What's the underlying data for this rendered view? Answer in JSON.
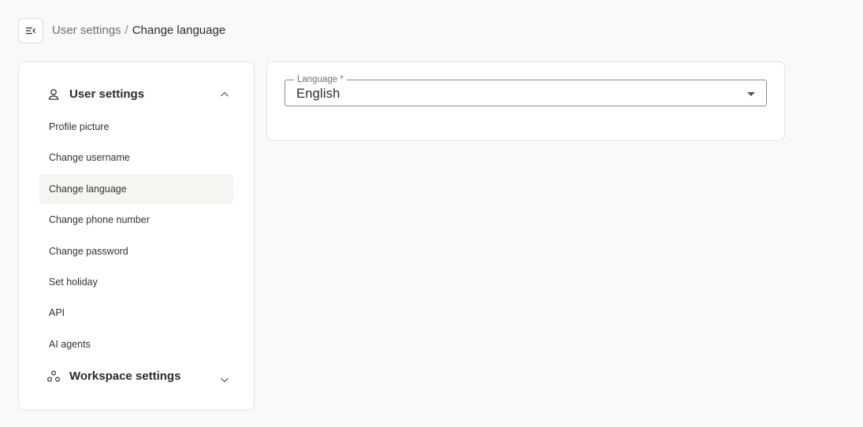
{
  "header": {
    "toggle_icon": "sidebar-collapse-icon",
    "breadcrumb": {
      "parent": "User settings",
      "separator": "/",
      "current": "Change language"
    }
  },
  "sidebar": {
    "groups": [
      {
        "label": "User settings",
        "icon": "user-icon",
        "expanded": true,
        "items": [
          {
            "label": "Profile picture"
          },
          {
            "label": "Change username"
          },
          {
            "label": "Change language",
            "active": true
          },
          {
            "label": "Change phone number"
          },
          {
            "label": "Change password"
          },
          {
            "label": "Set holiday"
          },
          {
            "label": "API"
          },
          {
            "label": "AI agents"
          }
        ]
      },
      {
        "label": "Workspace settings",
        "icon": "workspace-icon",
        "expanded": false
      }
    ]
  },
  "main": {
    "language_field": {
      "label": "Language *",
      "value": "English"
    }
  },
  "colors": {
    "background": "#f9f9f9",
    "card": "#ffffff",
    "border": "#e3e3e3",
    "active_item": "#f6f5f2",
    "text": "#2b2b2b",
    "muted": "#707070"
  }
}
